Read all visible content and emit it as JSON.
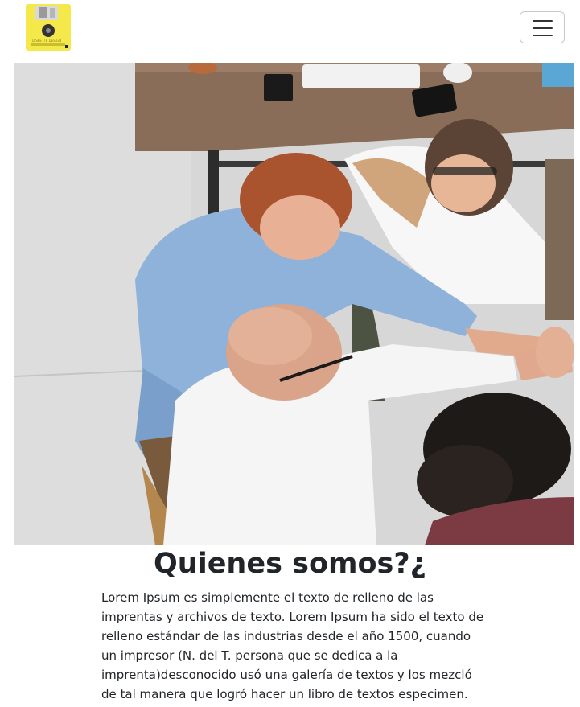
{
  "navbar": {
    "logo_label": "diskette logo",
    "logo_caption": "DISKETTE DESIGN",
    "toggle_label": "Toggle navigation",
    "accent_color": "#f4e84a"
  },
  "hero": {
    "alt": "Team putting hands together over a table"
  },
  "about": {
    "title": "Quienes somos?¿",
    "body": "Lorem Ipsum es simplemente el texto de relleno de las imprentas y archivos de texto. Lorem Ipsum ha sido el texto de relleno estándar de las industrias desde el año 1500, cuando un impresor (N. del T. persona que se dedica a la imprenta)desconocido usó una galería de textos y los mezcló de tal manera que logró hacer un libro de textos especimen."
  }
}
